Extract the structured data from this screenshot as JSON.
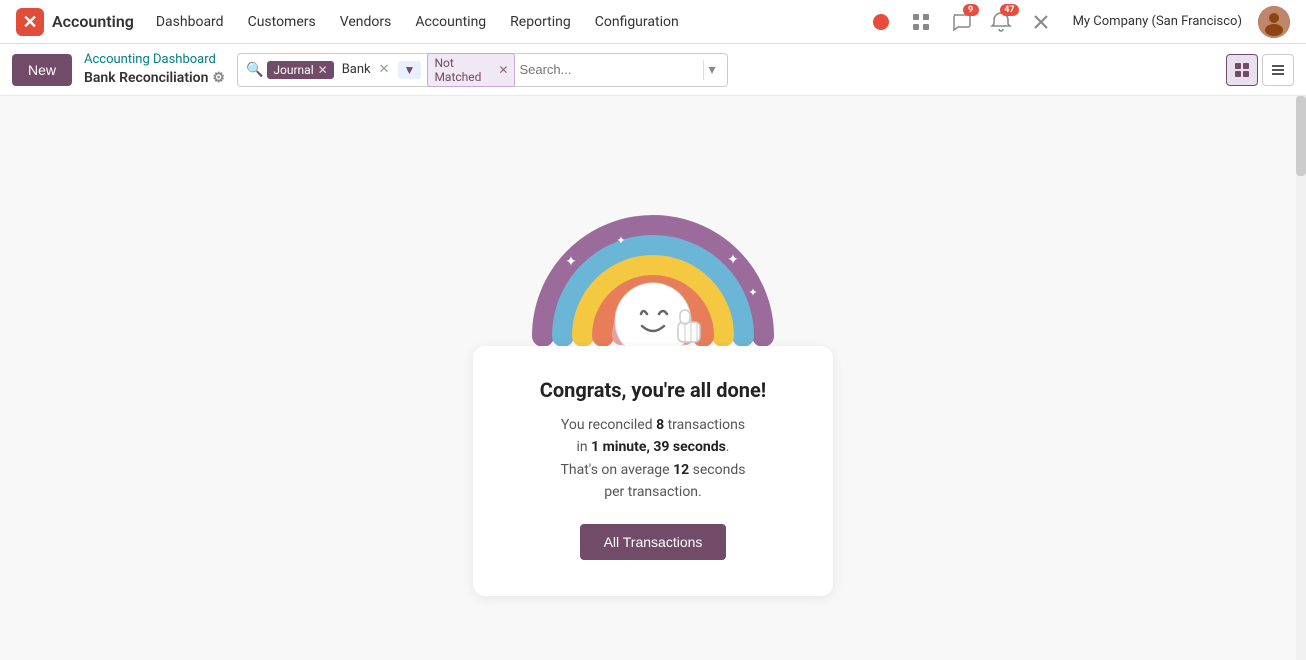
{
  "nav": {
    "logo_text": "Accounting",
    "items": [
      "Dashboard",
      "Customers",
      "Vendors",
      "Accounting",
      "Reporting",
      "Configuration"
    ],
    "company": "My Company (San Francisco)",
    "badge_messages": "9",
    "badge_notifications": "47"
  },
  "toolbar": {
    "new_label": "New",
    "breadcrumb_parent": "Accounting Dashboard",
    "breadcrumb_current": "Bank Reconciliation",
    "filter_journal_label": "Journal",
    "filter_journal_value": "Bank",
    "filter_status_label": "Not Matched",
    "search_placeholder": "Search...",
    "view_kanban": "⊞",
    "view_list": "☰"
  },
  "content": {
    "congrats_title": "Congrats, you're all done!",
    "congrats_line1_prefix": "You reconciled ",
    "congrats_transactions": "8",
    "congrats_line1_suffix": " transactions",
    "congrats_line2_prefix": "in ",
    "congrats_time": "1 minute, 39 seconds",
    "congrats_line2_suffix": ".",
    "congrats_line3_prefix": "That's on average ",
    "congrats_avg": "12",
    "congrats_line3_suffix": " seconds",
    "congrats_line4": "per transaction.",
    "btn_all_transactions": "All Transactions"
  }
}
